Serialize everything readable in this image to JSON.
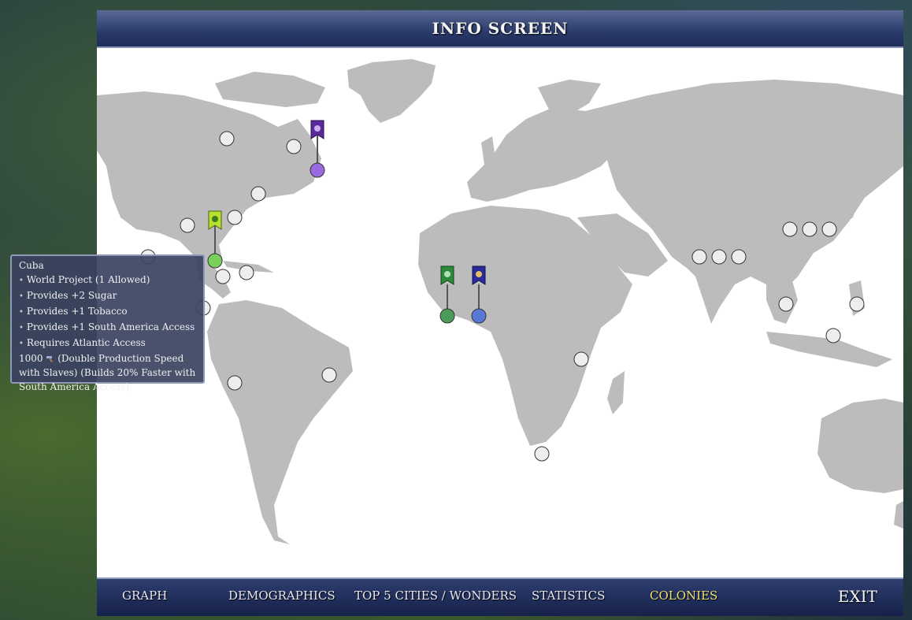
{
  "title": "INFO SCREEN",
  "tabs": [
    {
      "label": "GRAPH",
      "active": false
    },
    {
      "label": "DEMOGRAPHICS",
      "active": false
    },
    {
      "label": "TOP 5 CITIES / WONDERS",
      "active": false
    },
    {
      "label": "STATISTICS",
      "active": false
    },
    {
      "label": "COLONIES",
      "active": true
    }
  ],
  "exit_label": "EXIT",
  "tooltip": {
    "name": "Cuba",
    "bullets": [
      "World Project (1 Allowed)",
      "Provides +2  Sugar",
      "Provides +1  Tobacco",
      "Provides +1  South America Access",
      "Requires Atlantic Access"
    ],
    "cost": "1000",
    "cost_icon": "hammer-icon",
    "description": "(Double Production Speed with Slaves) (Builds 20% Faster with South America Access)"
  },
  "colors": {
    "purple_colony": "#9a6ae0",
    "lime_colony": "#7ad05a",
    "green_colony": "#4a9a5a",
    "blue_colony": "#5878d8",
    "empty_colony": "#eeeeee",
    "land": "#bcbcbc"
  }
}
